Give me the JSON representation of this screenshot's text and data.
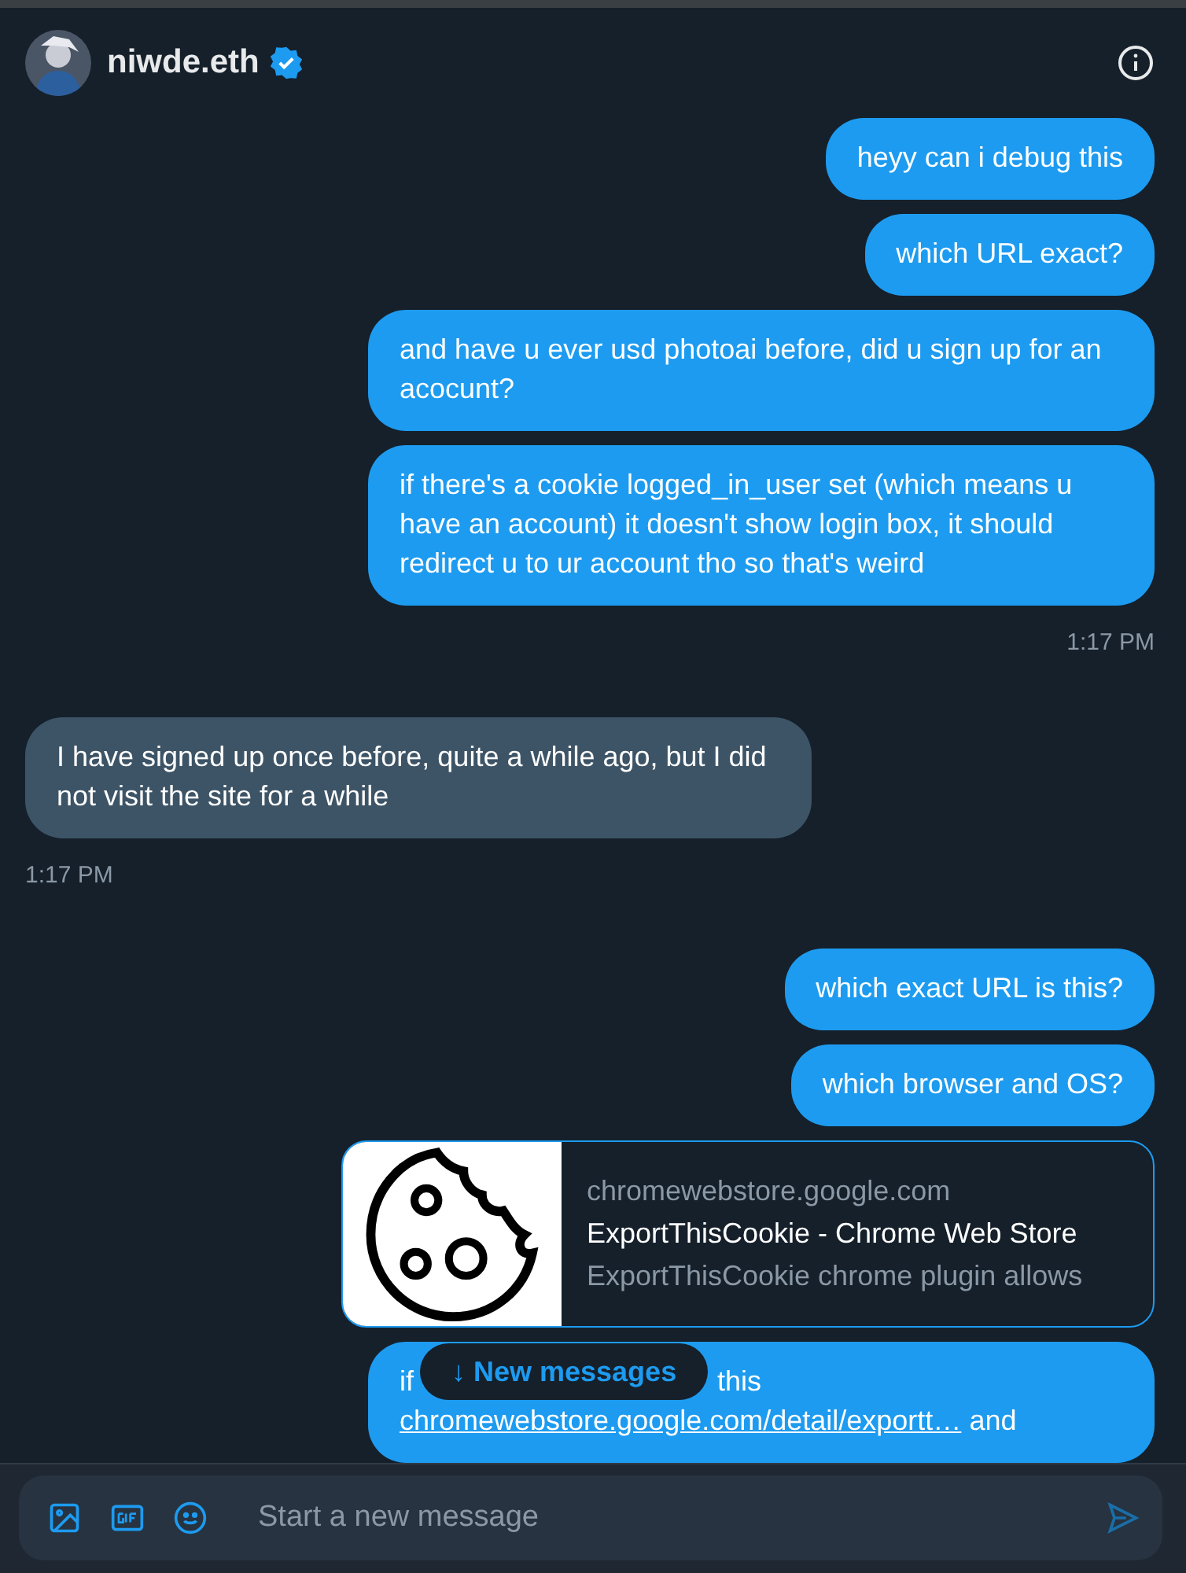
{
  "header": {
    "name": "niwde.eth",
    "verified": true
  },
  "messages": [
    {
      "kind": "sent-text",
      "text": "heyy can i debug this"
    },
    {
      "kind": "sent-text",
      "text": "which URL exact?"
    },
    {
      "kind": "sent-text",
      "text": "and have u ever usd photoai before, did u sign up for an acocunt?"
    },
    {
      "kind": "sent-text",
      "text": "if there's a cookie logged_in_user set (which means u have an account) it doesn't show login box, it should redirect u to ur account tho so that's weird"
    },
    {
      "kind": "sent-time",
      "text": "1:17 PM"
    },
    {
      "kind": "received-text",
      "text": "I have signed up once before, quite a while ago, but I did not visit the site for a while"
    },
    {
      "kind": "received-time",
      "text": "1:17 PM"
    },
    {
      "kind": "sent-text",
      "text": "which exact URL is this?"
    },
    {
      "kind": "sent-text",
      "text": "which browser and OS?"
    },
    {
      "kind": "sent-card",
      "domain": "chromewebstore.google.com",
      "title": "ExportThisCookie - Chrome Web Store",
      "description": "ExportThisCookie chrome plugin allows"
    },
    {
      "kind": "sent-link-text",
      "pre": "if",
      "mid": "this",
      "link": "chromewebstore.google.com/detail/exportt…",
      "post": "and"
    }
  ],
  "new_messages_pill": {
    "label": "↓ New messages"
  },
  "composer": {
    "placeholder": "Start a new message"
  }
}
